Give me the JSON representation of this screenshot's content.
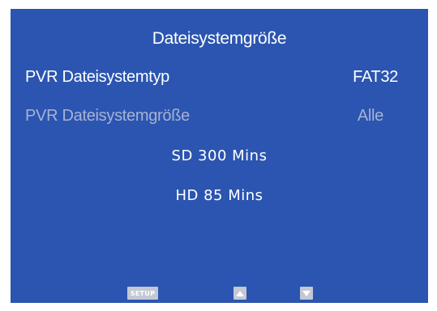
{
  "screen": {
    "title": "Dateisystemgröße",
    "rows": [
      {
        "label": "PVR Dateisystemtyp",
        "value": "FAT32",
        "state": "active"
      },
      {
        "label": "PVR Dateisystemgröße",
        "value": "Alle",
        "state": "dimmed"
      }
    ],
    "info": [
      "SD 300 Mins",
      "HD 85 Mins"
    ]
  },
  "footer": {
    "setup_label": "SETUP",
    "up_icon": "triangle-up-icon",
    "down_icon": "triangle-down-icon"
  },
  "colors": {
    "background": "#2b55b0",
    "text": "#ffffff",
    "dimmed_text": "#a7b2d3",
    "button": "#c3c8d4"
  }
}
